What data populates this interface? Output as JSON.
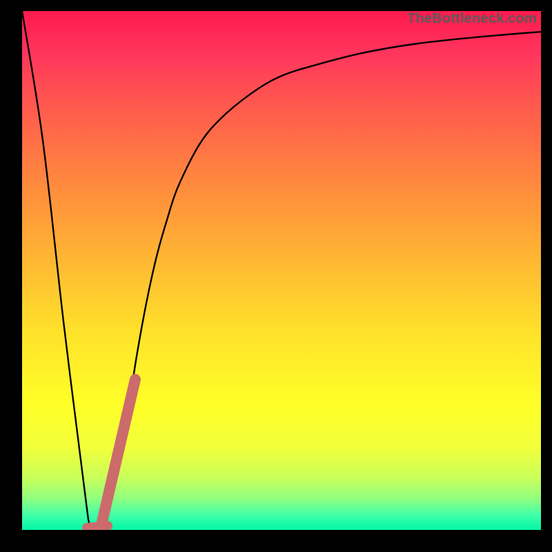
{
  "watermark": "TheBottleneck.com",
  "chart_data": {
    "type": "line",
    "title": "",
    "xlabel": "",
    "ylabel": "",
    "xlim": [
      0,
      100
    ],
    "ylim": [
      0,
      100
    ],
    "series": [
      {
        "name": "bottleneck-curve",
        "x": [
          0,
          4,
          8,
          12,
          13,
          14,
          15,
          16,
          18,
          20,
          22,
          24,
          26,
          28,
          30,
          34,
          38,
          44,
          50,
          58,
          66,
          76,
          88,
          100
        ],
        "y": [
          100,
          75,
          40,
          8,
          1,
          0,
          0.5,
          2,
          9,
          20,
          33,
          44,
          53,
          60,
          66,
          74,
          79,
          84,
          87.5,
          90,
          92,
          93.7,
          95,
          96
        ]
      }
    ],
    "highlight": {
      "name": "recommended-range",
      "x_start": 15.2,
      "y_start": 0.6,
      "x_end": 21.8,
      "y_end": 29,
      "color": "#cc6b6b"
    }
  }
}
